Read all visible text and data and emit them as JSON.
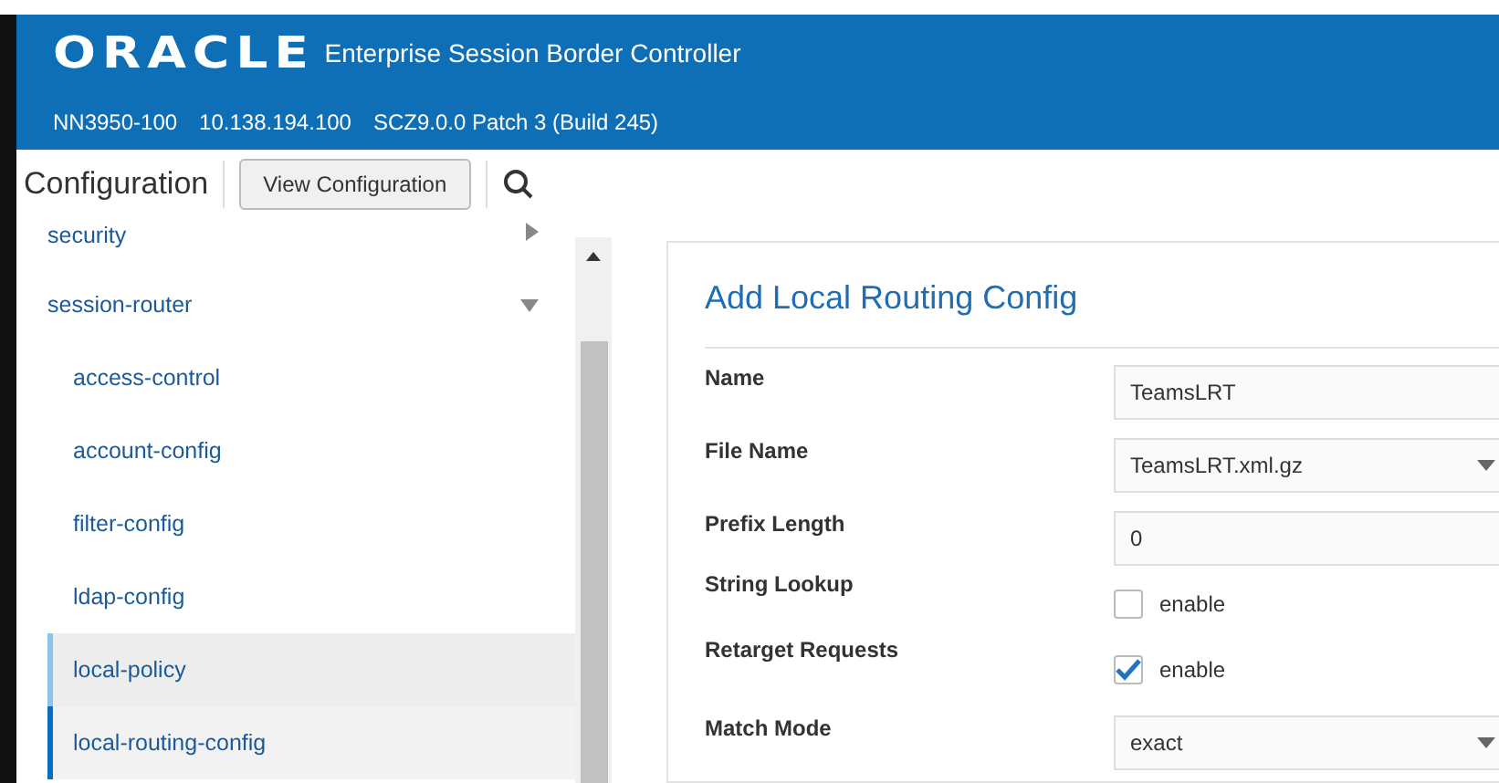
{
  "header": {
    "logo": "ORACLE",
    "product": "Enterprise Session Border Controller",
    "info": [
      "NN3950-100",
      "10.138.194.100",
      "SCZ9.0.0 Patch 3 (Build 245)"
    ]
  },
  "toolbar": {
    "title": "Configuration",
    "button": "View Configuration"
  },
  "sidebar": {
    "items": [
      {
        "label": "security",
        "expanded": false,
        "selected": false,
        "hovered": false
      },
      {
        "label": "session-router",
        "expanded": true,
        "selected": false,
        "hovered": false,
        "children": [
          {
            "label": "access-control",
            "selected": false,
            "hovered": false
          },
          {
            "label": "account-config",
            "selected": false,
            "hovered": false
          },
          {
            "label": "filter-config",
            "selected": false,
            "hovered": false
          },
          {
            "label": "ldap-config",
            "selected": false,
            "hovered": false
          },
          {
            "label": "local-policy",
            "selected": false,
            "hovered": true
          },
          {
            "label": "local-routing-config",
            "selected": true,
            "hovered": false
          }
        ]
      }
    ]
  },
  "form": {
    "title": "Add Local Routing Config",
    "fields": [
      {
        "kind": "text",
        "label": "Name",
        "value": "TeamsLRT"
      },
      {
        "kind": "select",
        "label": "File Name",
        "value": "TeamsLRT.xml.gz"
      },
      {
        "kind": "text",
        "label": "Prefix Length",
        "value": "0"
      },
      {
        "kind": "checkbox",
        "label": "String Lookup",
        "option": "enable",
        "checked": false
      },
      {
        "kind": "checkbox",
        "label": "Retarget Requests",
        "option": "enable",
        "checked": true
      },
      {
        "kind": "select",
        "label": "Match Mode",
        "value": "exact"
      }
    ]
  }
}
